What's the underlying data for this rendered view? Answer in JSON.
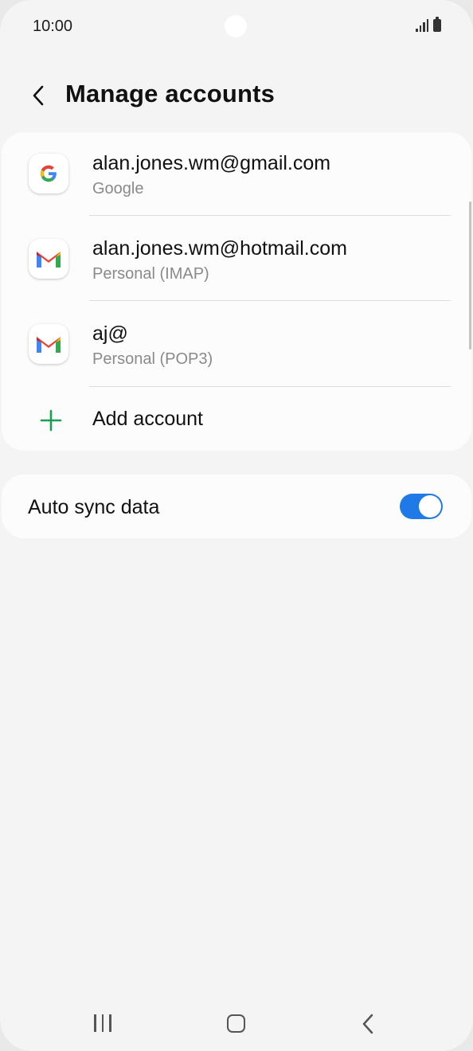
{
  "status_bar": {
    "time": "10:00"
  },
  "header": {
    "title": "Manage accounts"
  },
  "accounts": [
    {
      "email": "alan.jones.wm@gmail.com",
      "type": "Google",
      "icon": "google-icon"
    },
    {
      "email": "alan.jones.wm@hotmail.com",
      "type": "Personal (IMAP)",
      "icon": "gmail-icon"
    },
    {
      "email": "aj@",
      "type": "Personal (POP3)",
      "icon": "gmail-icon"
    }
  ],
  "add_account": {
    "label": "Add account"
  },
  "sync": {
    "label": "Auto sync data",
    "enabled": true
  },
  "colors": {
    "toggle_on": "#1f7ae8",
    "add_icon": "#1a9e55",
    "background": "#f4f4f4"
  }
}
